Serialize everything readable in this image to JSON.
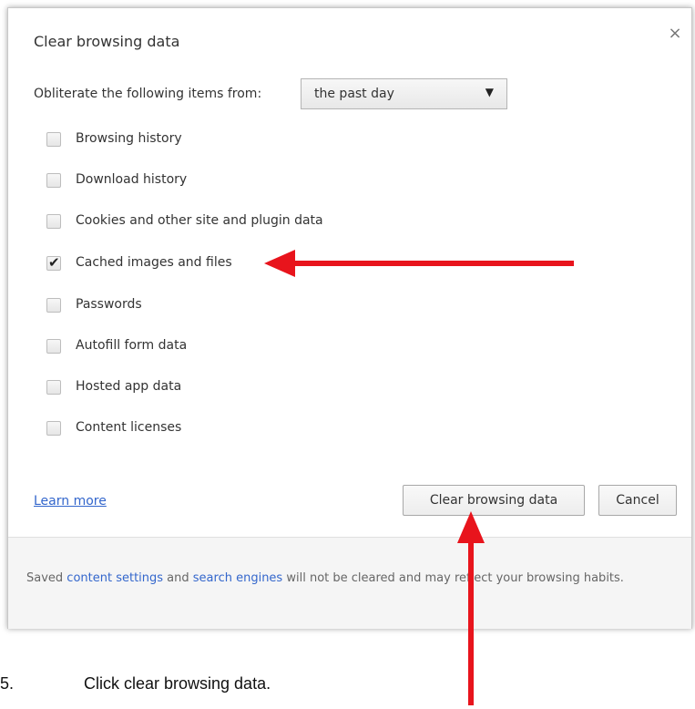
{
  "dialog": {
    "title": "Clear browsing data",
    "close_label": "×",
    "period_label": "Obliterate the following items from:",
    "period_value": "the past day",
    "period_arrow": "▼",
    "options": [
      {
        "label": "Browsing history",
        "checked": false
      },
      {
        "label": "Download history",
        "checked": false
      },
      {
        "label": "Cookies and other site and plugin data",
        "checked": false
      },
      {
        "label": "Cached images and files",
        "checked": true
      },
      {
        "label": "Passwords",
        "checked": false
      },
      {
        "label": "Autofill form data",
        "checked": false
      },
      {
        "label": "Hosted app data",
        "checked": false
      },
      {
        "label": "Content licenses",
        "checked": false
      }
    ],
    "learn_more": "Learn more",
    "clear_button": "Clear browsing data",
    "cancel_button": "Cancel",
    "footer": {
      "prefix": "Saved ",
      "link1": "content settings",
      "mid": " and ",
      "link2": "search engines",
      "suffix": " will not be cleared and may reflect your browsing habits."
    }
  },
  "instruction": {
    "number": "5.",
    "text": "Click clear browsing data."
  },
  "colors": {
    "annotation_arrow": "#e8141c",
    "link": "#3366cc"
  }
}
